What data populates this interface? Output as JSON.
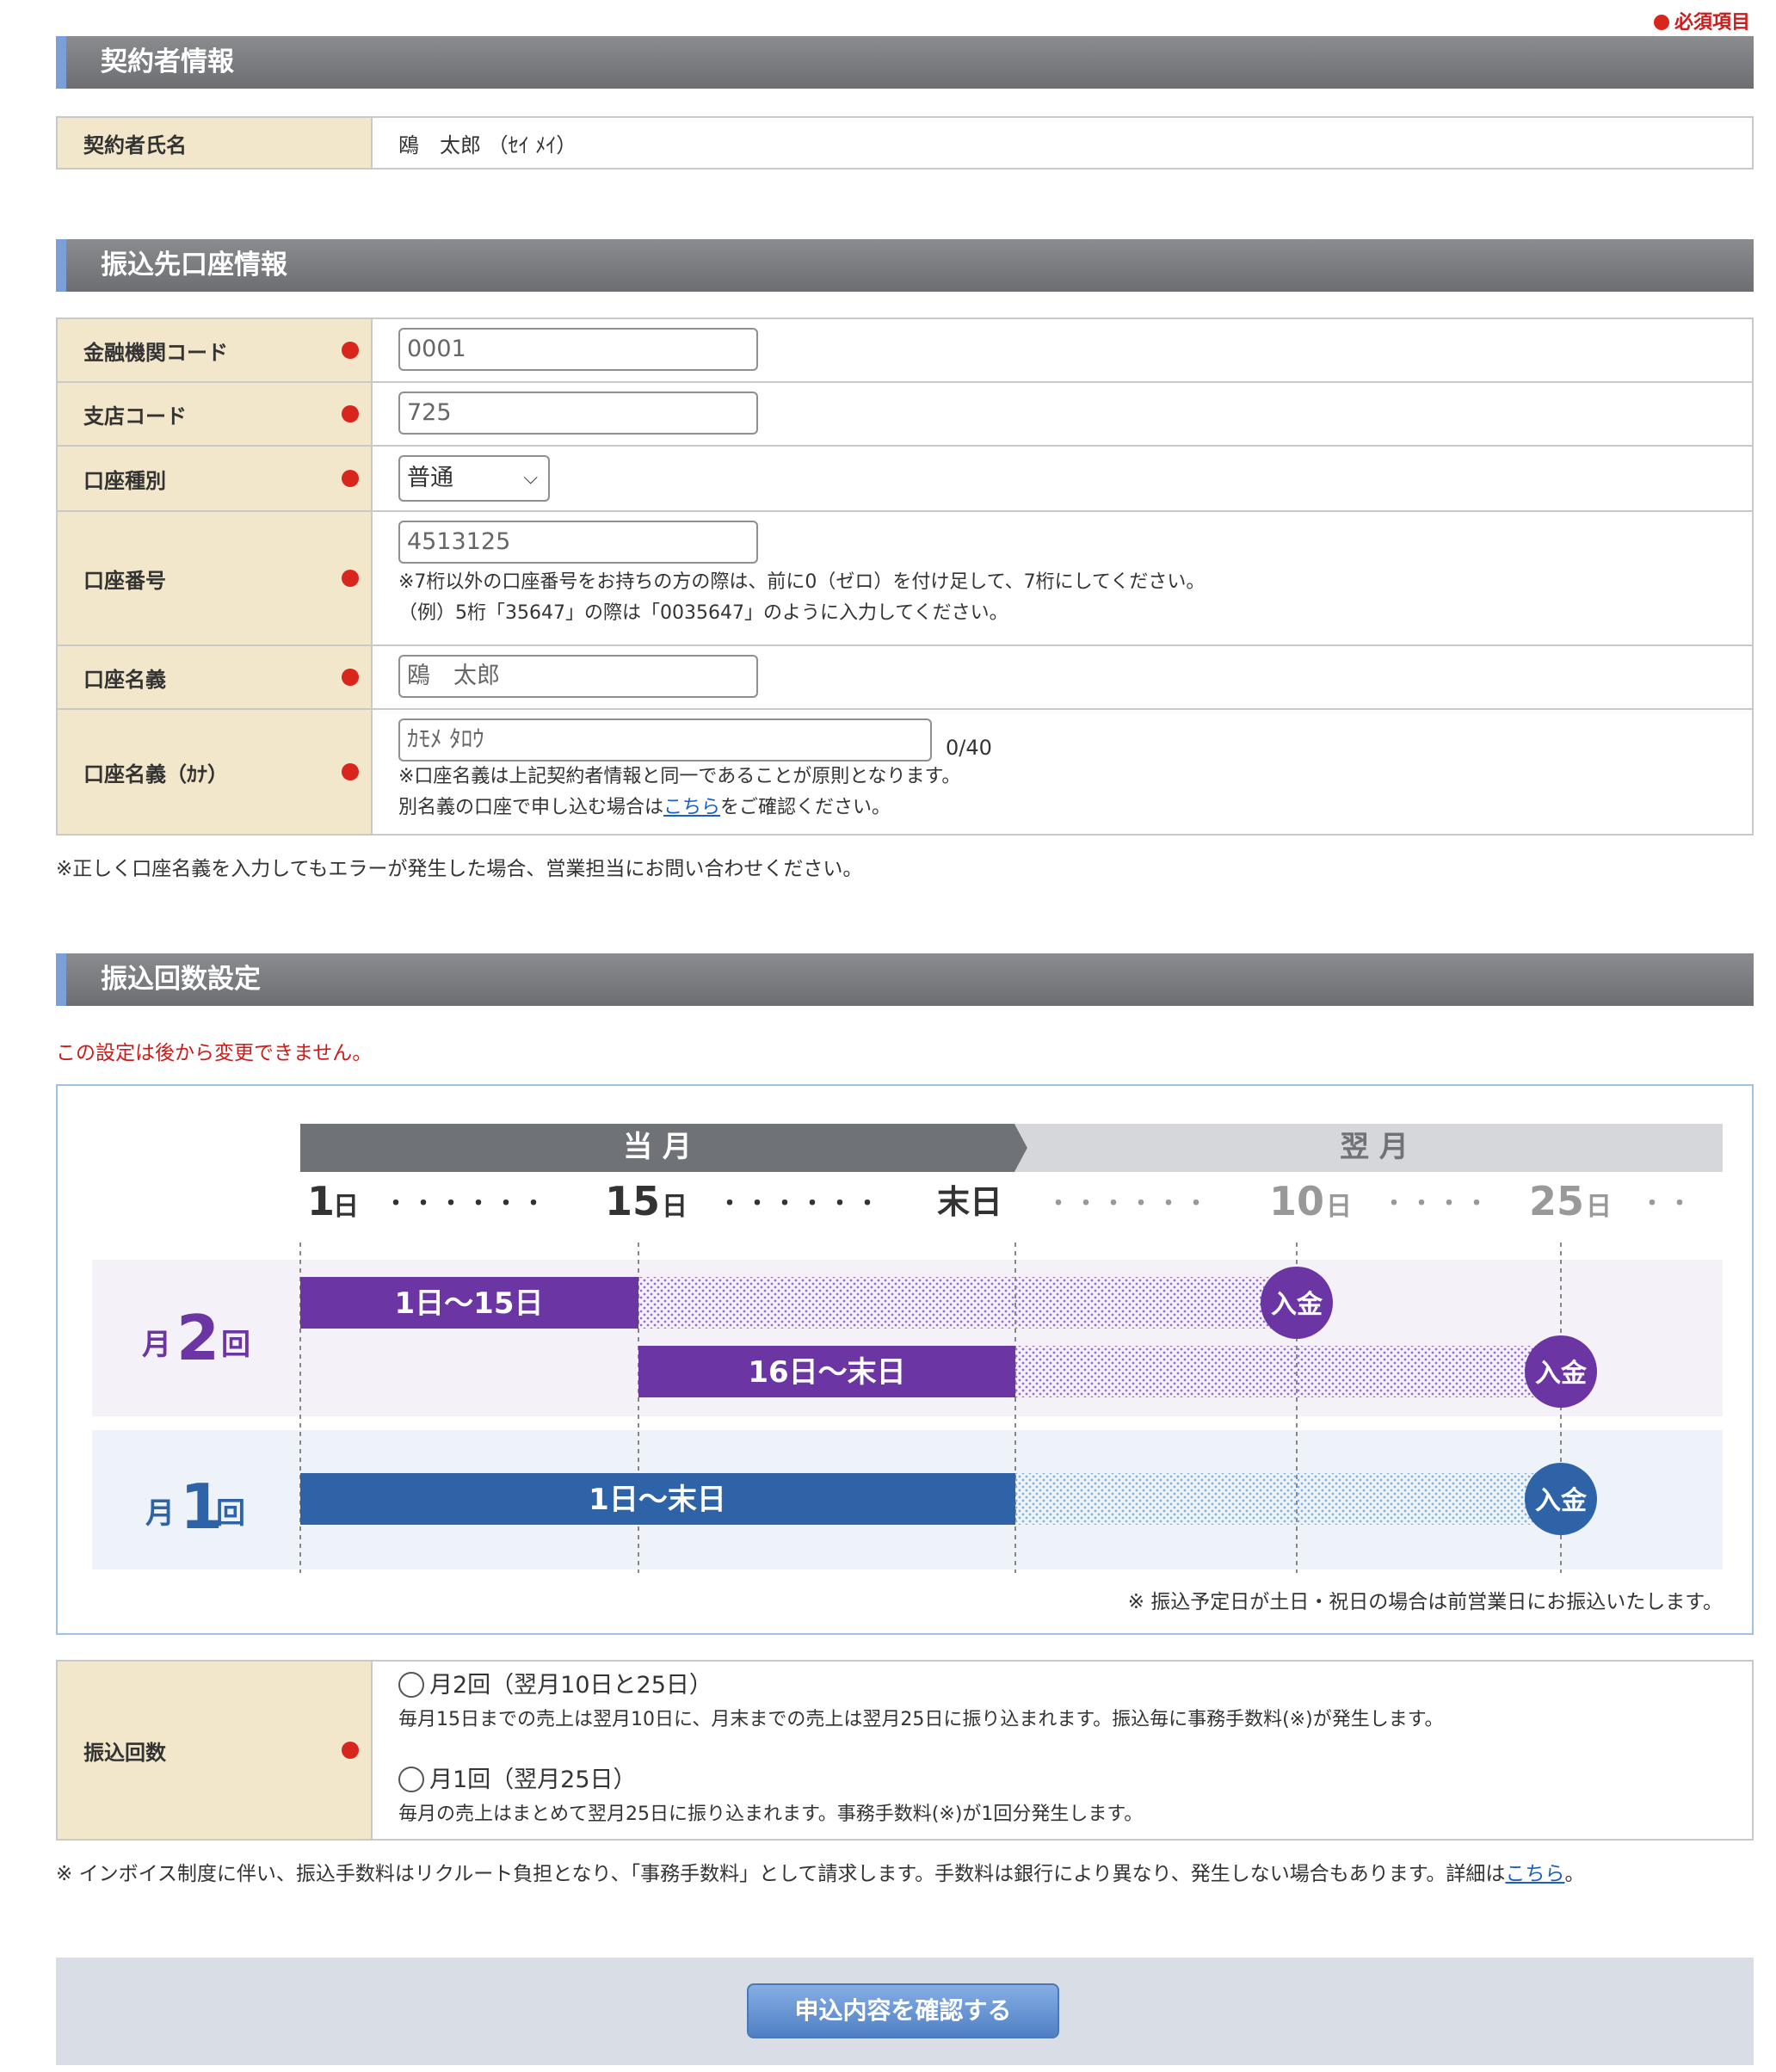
{
  "required_legend": "必須項目",
  "sections": {
    "contractor": "契約者情報",
    "account": "振込先口座情報",
    "frequency": "振込回数設定"
  },
  "contractor": {
    "label": "契約者氏名",
    "value": "鴎　太郎 （ｾｲ ﾒｲ）"
  },
  "account": {
    "bank_code": {
      "label": "金融機関コード",
      "value": "0001"
    },
    "branch_code": {
      "label": "支店コード",
      "value": "725"
    },
    "account_type": {
      "label": "口座種別",
      "value": "普通"
    },
    "account_number": {
      "label": "口座番号",
      "value": "4513125",
      "note1": "※7桁以外の口座番号をお持ちの方の際は、前に0（ゼロ）を付け足して、7桁にしてください。",
      "note2": "（例）5桁「35647」の際は「0035647」のように入力してください。"
    },
    "holder_name": {
      "label": "口座名義",
      "value": "鴎　太郎"
    },
    "holder_kana": {
      "label": "口座名義（ｶﾅ）",
      "value": "ｶﾓﾒ ﾀﾛｳ",
      "counter": "0/40",
      "note1": "※口座名義は上記契約者情報と同一であることが原則となります。",
      "note2_before": "別名義の口座で申し込む場合は",
      "note2_link": "こちら",
      "note2_after": "をご確認ください。"
    },
    "footnote": "※正しく口座名義を入力してもエラーが発生した場合、営業担当にお問い合わせください。"
  },
  "frequency": {
    "warning": "この設定は後から変更できません。",
    "chart": {
      "month_current": "当 月",
      "month_next": "翌 月",
      "timeline": {
        "d1_num": "1",
        "d1_unit": "日",
        "d15_num": "15",
        "d15_unit": "日",
        "end": "末日",
        "d10_num": "10",
        "d10_unit": "日",
        "d25_num": "25",
        "d25_unit": "日",
        "dots_a": "・・・・・・",
        "dots_b": "・・・・・・",
        "dots_c": "・・・・・・",
        "dots_d": "・・・・",
        "dots_e": "・・"
      },
      "twice": {
        "prefix": "月",
        "num": "2",
        "suffix": "回",
        "bar1": "1日～15日",
        "bar2": "16日～末日"
      },
      "once": {
        "prefix": "月",
        "num": "1",
        "suffix": "回",
        "bar": "1日～末日"
      },
      "deposit": "入金",
      "note": "※ 振込予定日が土日・祝日の場合は前営業日にお振込いたします。"
    },
    "field": {
      "label": "振込回数",
      "opt1_title": "月2回（翌月10日と25日）",
      "opt1_desc": "毎月15日までの売上は翌月10日に、月末までの売上は翌月25日に振り込まれます。振込毎に事務手数料(※)が発生します。",
      "opt2_title": "月1回（翌月25日）",
      "opt2_desc": "毎月の売上はまとめて翌月25日に振り込まれます。事務手数料(※)が1回分発生します。"
    },
    "footnote_before": "※ インボイス制度に伴い、振込手数料はリクルート負担となり、「事務手数料」として請求します。手数料は銀行により異なり、発生しない場合もあります。詳細は",
    "footnote_link": "こちら",
    "footnote_after": "。"
  },
  "submit": "申込内容を確認する",
  "colors": {
    "purple": "#6b35a3",
    "blue": "#2f63a8",
    "required": "#d9261c",
    "label_bg": "#f3e7cb"
  }
}
